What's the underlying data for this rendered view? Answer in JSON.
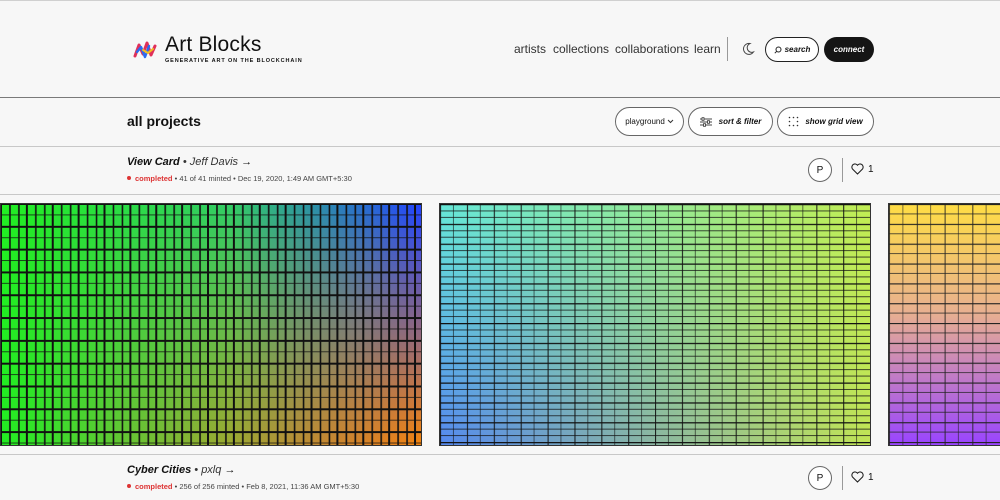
{
  "header": {
    "brand_title": "Art Blocks",
    "brand_subtitle": "GENERATIVE ART ON THE BLOCKCHAIN",
    "nav": [
      "artists",
      "collections",
      "collaborations",
      "learn"
    ],
    "search_label": "search",
    "connect_label": "connect",
    "icons": [
      "art-blocks-logo-icon",
      "moon-icon",
      "search-icon"
    ]
  },
  "toolbar": {
    "title": "all projects",
    "playground_label": "playground",
    "sort_filter_label": "sort & filter",
    "grid_view_label": "show grid view",
    "icons": [
      "chevron-down-icon",
      "sliders-icon",
      "grid-dots-icon"
    ]
  },
  "projects": [
    {
      "name": "View Card",
      "artist": "Jeff Davis",
      "status": "completed",
      "minted": "41 of 41 minted",
      "date": "Dec 19, 2020, 1:49 AM GMT+5:30",
      "profile_initial": "P",
      "likes": "1"
    },
    {
      "name": "Cyber Cities",
      "artist": "pxlq",
      "status": "completed",
      "minted": "256 of 256 minted",
      "date": "Feb 8, 2021, 11:36 AM GMT+5:30",
      "profile_initial": "P",
      "likes": "1"
    }
  ],
  "colors": {
    "connect_bg": "#151515",
    "completed": "#dd3333",
    "art1": [
      "#22ee22",
      "#2244ff",
      "#ff8800"
    ],
    "art2": [
      "#66e8d8",
      "#5588ee",
      "#ccee44"
    ],
    "art3": [
      "#ffdd44",
      "#9944ff"
    ]
  }
}
